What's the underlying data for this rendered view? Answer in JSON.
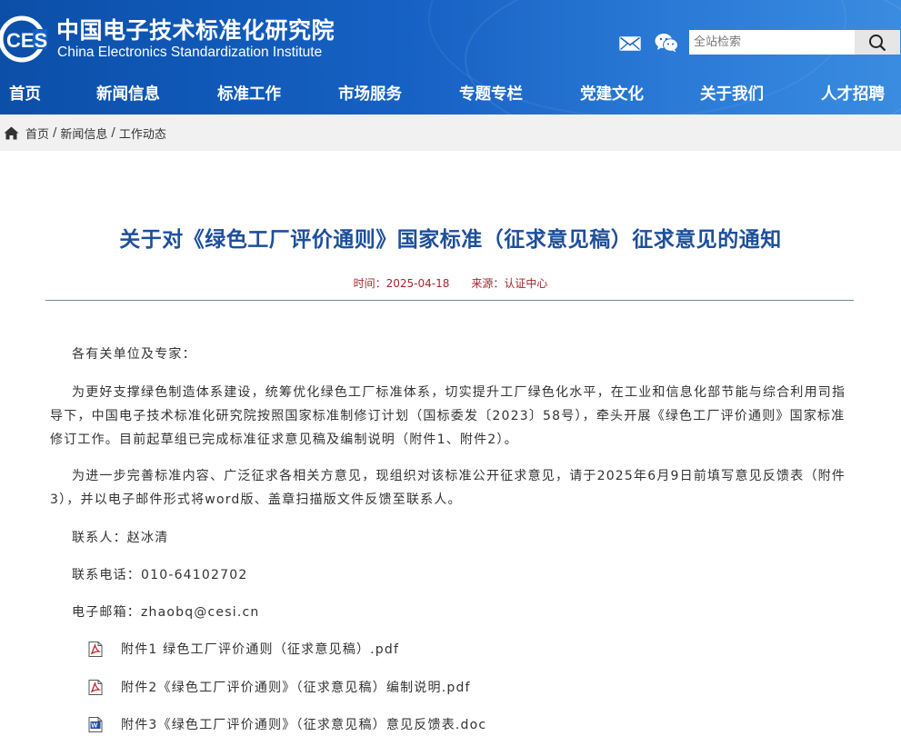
{
  "header": {
    "logo_text": "CESI",
    "org_name_cn": "中国电子技术标准化研究院",
    "org_name_en": "China Electronics Standardization Institute",
    "search_placeholder": "全站检索"
  },
  "nav": {
    "items": [
      {
        "label": "首页"
      },
      {
        "label": "新闻信息"
      },
      {
        "label": "标准工作"
      },
      {
        "label": "市场服务"
      },
      {
        "label": "专题专栏"
      },
      {
        "label": "党建文化"
      },
      {
        "label": "关于我们"
      },
      {
        "label": "人才招聘"
      }
    ]
  },
  "breadcrumb": {
    "items": [
      "首页",
      "新闻信息",
      "工作动态"
    ],
    "separator": "/"
  },
  "article": {
    "title": "关于对《绿色工厂评价通则》国家标准（征求意见稿）征求意见的通知",
    "date": "时间：2025-04-18",
    "source": "来源：认证中心",
    "salutation": "各有关单位及专家：",
    "para1": "为更好支撑绿色制造体系建设，统筹优化绿色工厂标准体系，切实提升工厂绿色化水平，在工业和信息化部节能与综合利用司指导下，中国电子技术标准化研究院按照国家标准制修订计划（国标委发〔2023〕58号），牵头开展《绿色工厂评价通则》国家标准修订工作。目前起草组已完成标准征求意见稿及编制说明（附件1、附件2）。",
    "para2": "为进一步完善标准内容、广泛征求各相关方意见，现组织对该标准公开征求意见，请于2025年6月9日前填写意见反馈表（附件3），并以电子邮件形式将word版、盖章扫描版文件反馈至联系人。",
    "contact": "联系人：赵冰清",
    "phone": "联系电话：010-64102702",
    "email": "电子邮箱：zhaobq@cesi.cn",
    "attachments": [
      {
        "name": "附件1 绿色工厂评价通则（征求意见稿）.pdf",
        "type": "pdf"
      },
      {
        "name": "附件2《绿色工厂评价通则》（征求意见稿）编制说明.pdf",
        "type": "pdf"
      },
      {
        "name": "附件3《绿色工厂评价通则》（征求意见稿）意见反馈表.doc",
        "type": "doc"
      }
    ]
  },
  "colors": {
    "header_blue": "#0b4fa8",
    "title_blue": "#1d4f9b",
    "meta_red": "#a4262c"
  }
}
